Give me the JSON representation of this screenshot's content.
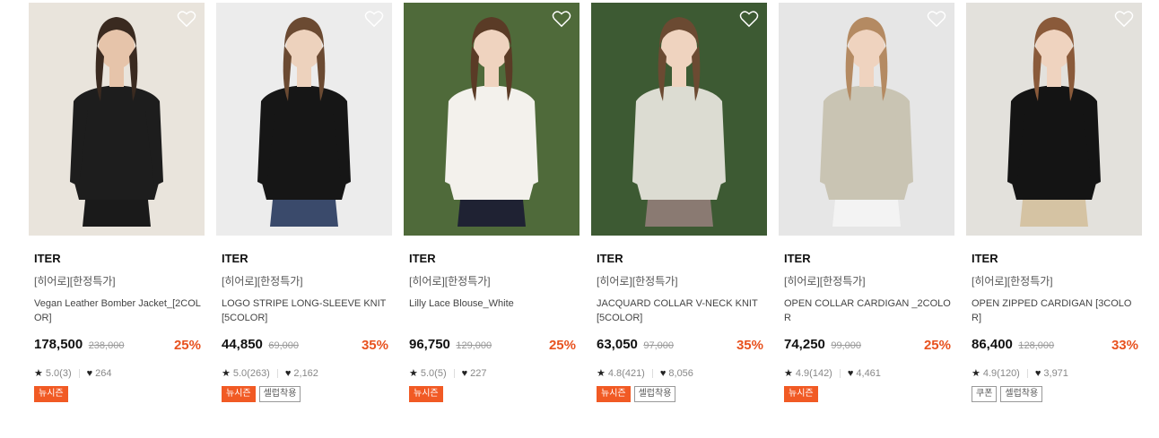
{
  "products": [
    {
      "brand": "ITER",
      "tag": "[히어로][한정특가]",
      "name": "Vegan Leather Bomber Jacket_[2COLOR]",
      "price": "178,500",
      "original_price": "238,000",
      "discount": "25%",
      "rating": "5.0(3)",
      "likes": "264",
      "badges": [
        {
          "label": "뉴시즌",
          "style": "orange"
        }
      ],
      "colors": {
        "bg": "#e9e4dc",
        "top": "#1d1d1d",
        "hair": "#3a2a20",
        "skin": "#e6c4aa",
        "bottom": "#1a1a1a"
      }
    },
    {
      "brand": "ITER",
      "tag": "[히어로][한정특가]",
      "name": "LOGO STRIPE LONG-SLEEVE KNIT [5COLOR]",
      "price": "44,850",
      "original_price": "69,000",
      "discount": "35%",
      "rating": "5.0(263)",
      "likes": "2,162",
      "badges": [
        {
          "label": "뉴시즌",
          "style": "orange"
        },
        {
          "label": "셀럽착용",
          "style": "outline"
        }
      ],
      "colors": {
        "bg": "#ececec",
        "top": "#161616",
        "hair": "#6b4a32",
        "skin": "#edd2bd",
        "bottom": "#3a4a6b"
      }
    },
    {
      "brand": "ITER",
      "tag": "[히어로][한정특가]",
      "name": "Lilly Lace Blouse_White",
      "price": "96,750",
      "original_price": "129,000",
      "discount": "25%",
      "rating": "5.0(5)",
      "likes": "227",
      "badges": [
        {
          "label": "뉴시즌",
          "style": "orange"
        }
      ],
      "colors": {
        "bg": "#4f6a3a",
        "top": "#f3f1ec",
        "hair": "#5a3b26",
        "skin": "#efd3bf",
        "bottom": "#1f2233"
      }
    },
    {
      "brand": "ITER",
      "tag": "[히어로][한정특가]",
      "name": "JACQUARD COLLAR V-NECK KNIT [5COLOR]",
      "price": "63,050",
      "original_price": "97,000",
      "discount": "35%",
      "rating": "4.8(421)",
      "likes": "8,056",
      "badges": [
        {
          "label": "뉴시즌",
          "style": "orange"
        },
        {
          "label": "셀럽착용",
          "style": "outline"
        }
      ],
      "colors": {
        "bg": "#3d5a33",
        "top": "#dcdcd2",
        "hair": "#6b4a32",
        "skin": "#efd3bf",
        "bottom": "#8a7a72"
      }
    },
    {
      "brand": "ITER",
      "tag": "[히어로][한정특가]",
      "name": "OPEN COLLAR CARDIGAN _2COLOR",
      "price": "74,250",
      "original_price": "99,000",
      "discount": "25%",
      "rating": "4.9(142)",
      "likes": "4,461",
      "badges": [
        {
          "label": "뉴시즌",
          "style": "orange"
        }
      ],
      "colors": {
        "bg": "#e6e6e6",
        "top": "#c9c4b3",
        "hair": "#b48a62",
        "skin": "#efd3bf",
        "bottom": "#f3f3f3"
      }
    },
    {
      "brand": "ITER",
      "tag": "[히어로][한정특가]",
      "name": "OPEN ZIPPED CARDIGAN [3COLOR]",
      "price": "86,400",
      "original_price": "128,000",
      "discount": "33%",
      "rating": "4.9(120)",
      "likes": "3,971",
      "badges": [
        {
          "label": "쿠폰",
          "style": "outline"
        },
        {
          "label": "셀럽착용",
          "style": "outline"
        }
      ],
      "colors": {
        "bg": "#e3e1dc",
        "top": "#141414",
        "hair": "#8a5a3a",
        "skin": "#efd3bf",
        "bottom": "#d5c3a3"
      }
    }
  ],
  "icons": {
    "wishlist": "heart-outline-icon",
    "star": "star-icon",
    "like": "heart-icon"
  }
}
